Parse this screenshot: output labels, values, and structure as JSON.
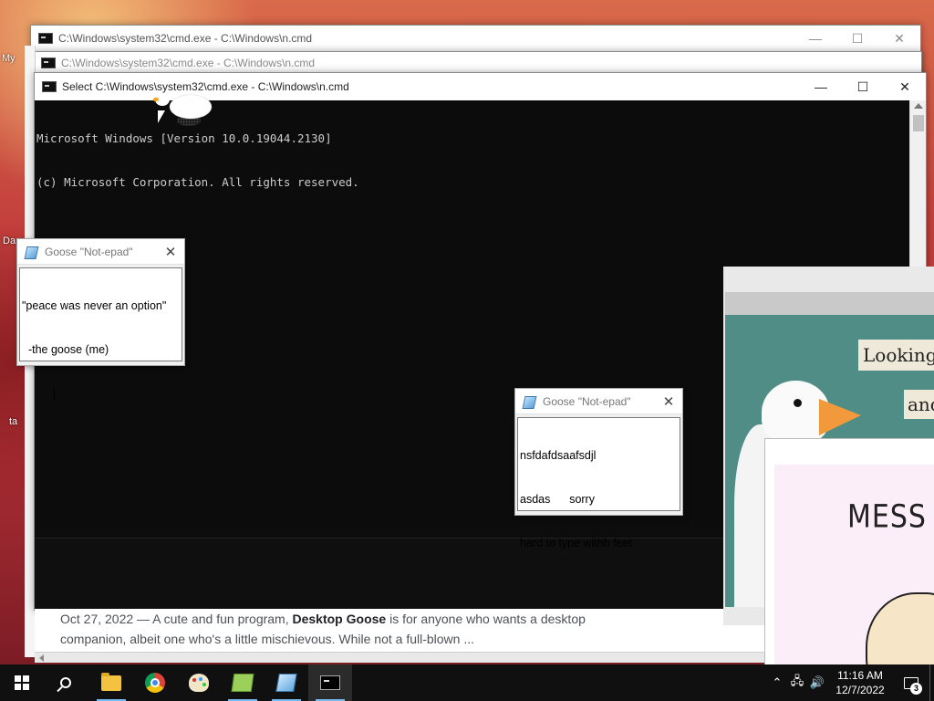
{
  "desktop": {
    "labels": [
      "My",
      "Da",
      "ta"
    ]
  },
  "cmd_back1": {
    "title": "C:\\Windows\\system32\\cmd.exe - C:\\Windows\\n.cmd"
  },
  "cmd_back2": {
    "title": "C:\\Windows\\system32\\cmd.exe - C:\\Windows\\n.cmd"
  },
  "cmd_main": {
    "title": "Select C:\\Windows\\system32\\cmd.exe - C:\\Windows\\n.cmd",
    "lines": [
      "Microsoft Windows [Version 10.0.19044.2130]",
      "(c) Microsoft Corporation. All rights reserved."
    ],
    "controls": {
      "minimize": "—",
      "maximize": "☐",
      "close": "✕"
    }
  },
  "notepad1": {
    "title": "Goose \"Not-epad\"",
    "close": "✕",
    "lines": [
      "\"peace was never an option\"",
      "  -the goose (me)",
      "          "
    ]
  },
  "notepad2": {
    "title": "Goose \"Not-epad\"",
    "close": "✕",
    "lines": [
      "nsfdafdsaafsdjl",
      "asdas      sorry",
      "hard to type withh feet"
    ]
  },
  "browser_snippet": {
    "date": "Oct 27, 2022",
    "sep": " — A cute and fun program, ",
    "bold": "Desktop Goose",
    "rest": " is for anyone who wants a desktop",
    "line2": "companion, albeit one who's a little mischievous. While not a full-blown ..."
  },
  "meme": {
    "looking": "Looking",
    "and": "and",
    "mess": "MESS WITH"
  },
  "taskbar": {
    "apps": [
      "start",
      "search",
      "file-explorer",
      "chrome",
      "paint-3d",
      "notepad-green",
      "goose-notepad",
      "cmd"
    ],
    "time": "11:16 AM",
    "date": "12/7/2022",
    "notification_count": "3",
    "tray": {
      "chevron": "⌃",
      "network": "🖧",
      "volume": "🔊"
    }
  }
}
